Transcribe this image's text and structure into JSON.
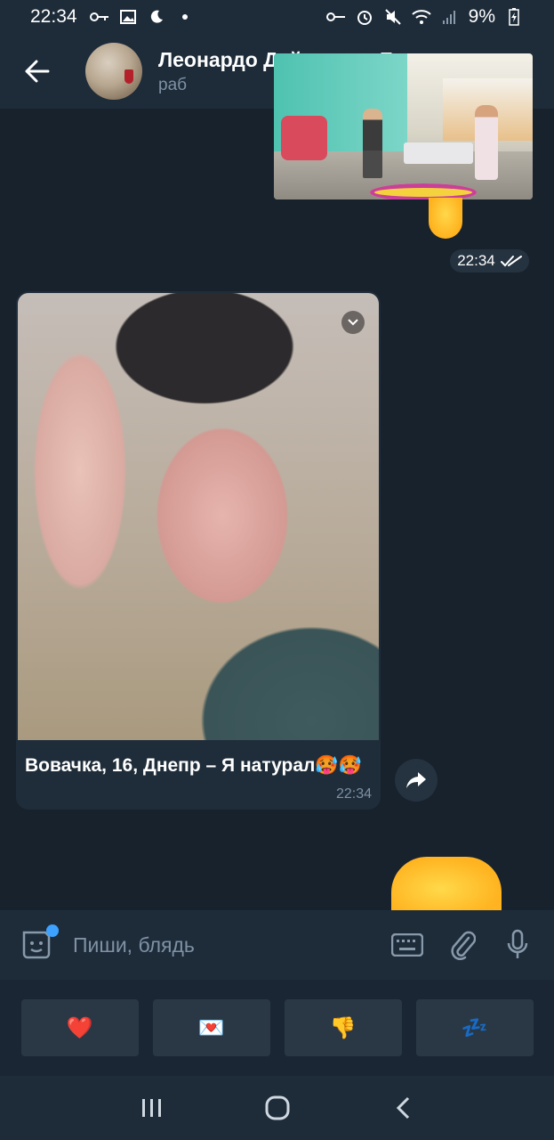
{
  "status_bar": {
    "time": "22:34",
    "battery": "9%"
  },
  "header": {
    "title": "Леонардо Дайвинчик Бот",
    "subtitle": "раб"
  },
  "sent_message": {
    "time": "22:34"
  },
  "received_message": {
    "caption": "Вовачка, 16, Днепр – Я натурал🥵🥵",
    "time": "22:34"
  },
  "input": {
    "placeholder": "Пиши, блядь"
  },
  "quick_replies": [
    "❤️",
    "💌",
    "👎",
    "💤"
  ],
  "colors": {
    "background": "#18222d",
    "bar": "#1e2c3a",
    "bubble": "#1f2d3a",
    "muted_text": "#7f91a4",
    "accent": "#3da1ff"
  }
}
